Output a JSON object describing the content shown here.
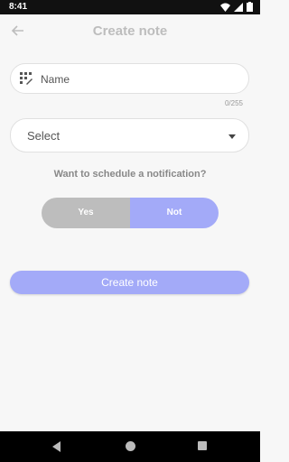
{
  "status": {
    "time": "8:41"
  },
  "appbar": {
    "title": "Create note"
  },
  "name_field": {
    "placeholder": "Name",
    "counter": "0/255"
  },
  "select": {
    "value": "Select"
  },
  "schedule": {
    "question": "Want to schedule a notification?",
    "yes_label": "Yes",
    "not_label": "Not",
    "selected": "Not"
  },
  "create_button": {
    "label": "Create note"
  },
  "colors": {
    "accent": "#a3aaf8",
    "inactive": "#bdbdbd",
    "background": "#f7f7f7"
  },
  "icons": [
    "back-arrow-icon",
    "pattern-icon",
    "dropdown-arrow-icon",
    "wifi-icon",
    "signal-icon",
    "battery-icon"
  ]
}
